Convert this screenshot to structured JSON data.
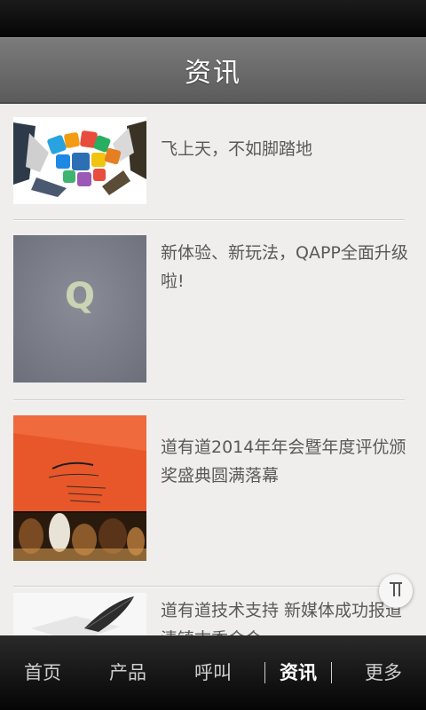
{
  "header": {
    "title": "资讯"
  },
  "news": [
    {
      "title": "飞上天，不如脚踏地",
      "image": "handshake-apps-image"
    },
    {
      "title": "新体验、新玩法，QAPP全面升级啦!",
      "image": "q-logo-image",
      "image_text": "Q"
    },
    {
      "title": "道有道2014年年会暨年度评优颁奖盛典圆满落幕",
      "image": "annual-meeting-image"
    },
    {
      "title": "道有道技术支持 新媒体成功报道清镇古季金会",
      "image": "feather-pen-image"
    }
  ],
  "tabs": [
    {
      "label": "首页",
      "active": false
    },
    {
      "label": "产品",
      "active": false
    },
    {
      "label": "呼叫",
      "active": false
    },
    {
      "label": "资讯",
      "active": true
    },
    {
      "label": "更多",
      "active": false
    }
  ],
  "icons": {
    "back_to_top": "back-to-top-icon"
  },
  "colors": {
    "header": "#6b6b6b",
    "tabbar": "#111111",
    "background": "#efeeec"
  }
}
